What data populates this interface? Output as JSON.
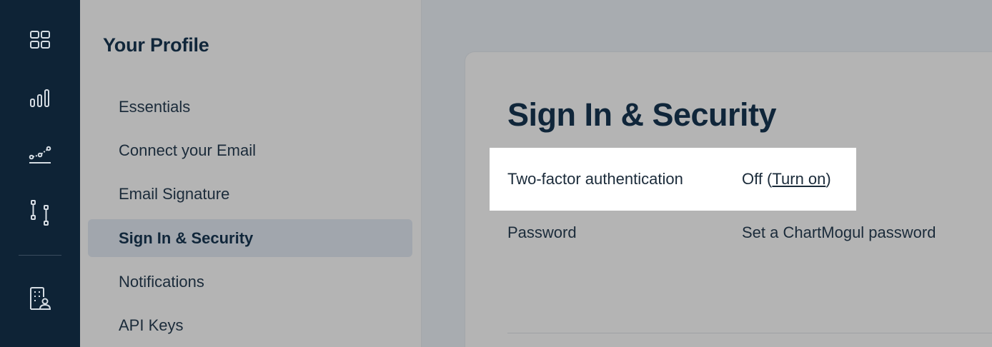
{
  "rail": {
    "icons": [
      "dashboard-grid-icon",
      "bar-chart-icon",
      "line-trend-icon",
      "pipeline-icon",
      "building-user-icon"
    ]
  },
  "sidebar": {
    "title": "Your Profile",
    "items": [
      {
        "label": "Essentials"
      },
      {
        "label": "Connect your Email"
      },
      {
        "label": "Email Signature"
      },
      {
        "label": "Sign In & Security",
        "active": true
      },
      {
        "label": "Notifications"
      },
      {
        "label": "API Keys"
      }
    ]
  },
  "main": {
    "title": "Sign In & Security",
    "rows": [
      {
        "label": "Two-factor authentication",
        "value_prefix": "Off (",
        "value_link": "Turn on",
        "value_suffix": ")"
      },
      {
        "label": "Password",
        "value_link": "Set a ChartMogul password"
      }
    ]
  },
  "colors": {
    "rail_bg": "#0e2336",
    "sidebar_bg": "#b4b4b4",
    "active_item_bg": "#a1a6ad",
    "text_dark": "#10263a",
    "highlight_bg": "#ffffff"
  }
}
